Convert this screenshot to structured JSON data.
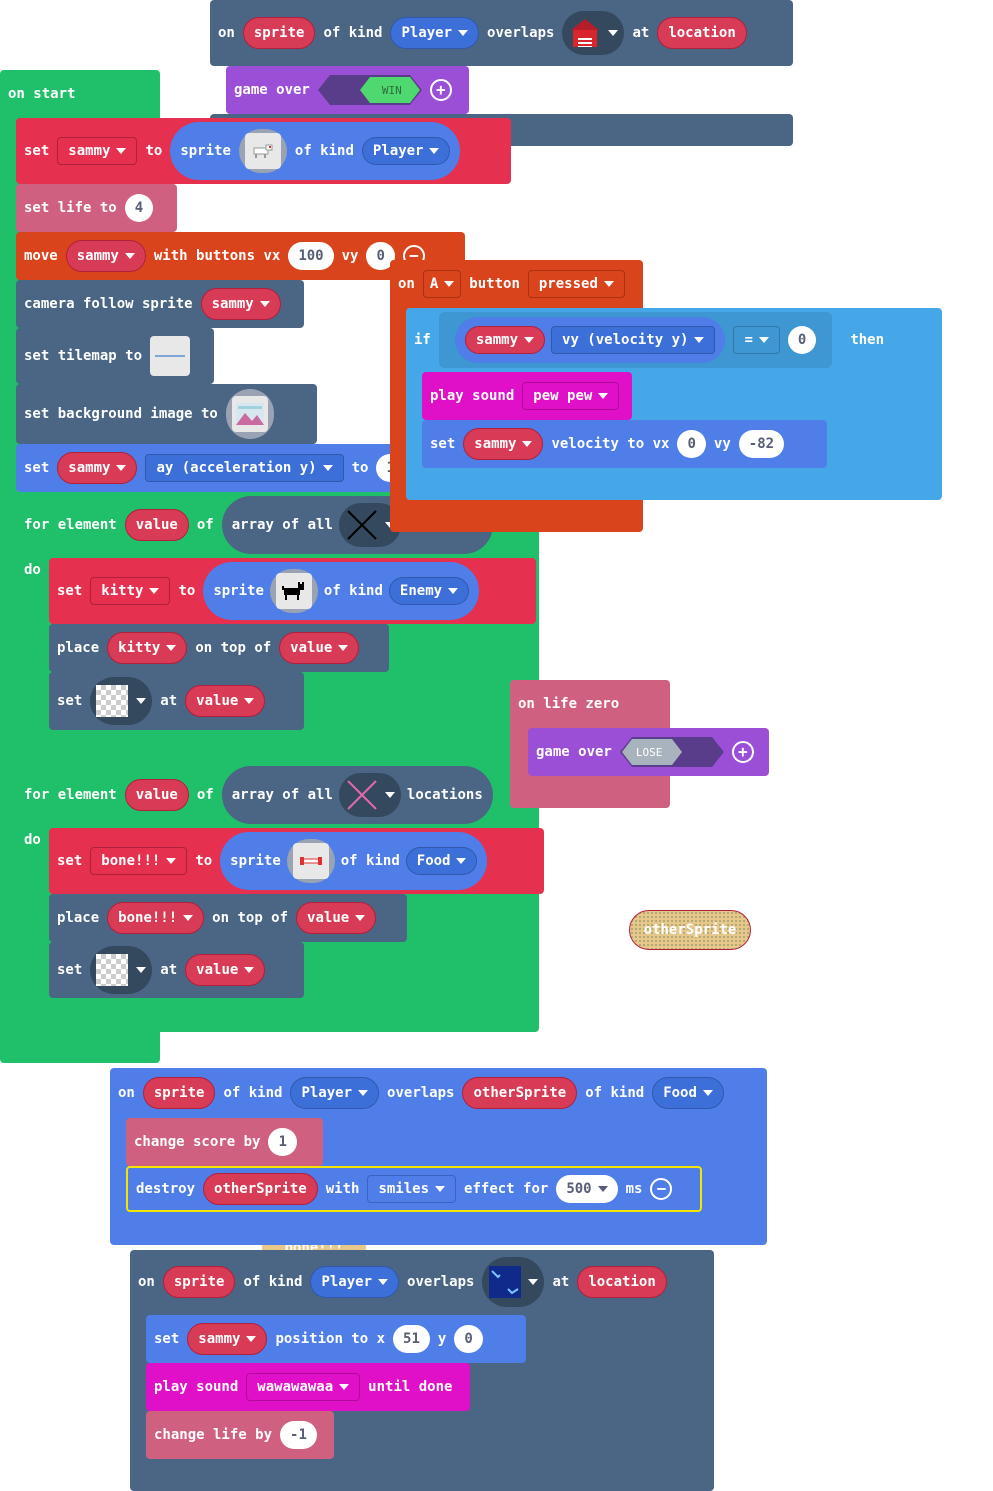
{
  "colors": {
    "green": "#20c06a",
    "red": "#e63050",
    "slate": "#4b6584",
    "pink": "#d06080",
    "purple": "#9b4fd6",
    "orange": "#d9441c",
    "sky": "#45a7e8",
    "blue": "#4f7ee8",
    "magenta": "#e010c8",
    "var": "#d83b56"
  },
  "top_overlap": {
    "on": "on",
    "sprite": "sprite",
    "of_kind": "of kind",
    "kind": "Player",
    "overlaps": "overlaps",
    "at": "at",
    "location": "location",
    "tile_icon": "red-house-icon",
    "game_over": "game over",
    "win": "WIN"
  },
  "on_start": {
    "label": "on start",
    "set": "set",
    "sammy": "sammy",
    "to": "to",
    "sprite": "sprite",
    "of_kind": "of kind",
    "player": "Player",
    "set_life_to": "set life to",
    "life": "4",
    "move": "move",
    "with_buttons_vx": "with buttons vx",
    "vx": "100",
    "vy_label": "vy",
    "vy": "0",
    "camera_follow": "camera follow sprite",
    "set_tilemap": "set tilemap to",
    "set_background": "set background image to",
    "ay": "ay (acceleration y)",
    "ay_to": "to",
    "ay_value": "100",
    "for_element": "for element",
    "value": "value",
    "of": "of",
    "array_of_all": "array of all",
    "locations": "locations",
    "do": "do",
    "kitty": "kitty",
    "enemy": "Enemy",
    "place": "place",
    "on_top_of": "on top of",
    "at": "at",
    "bone": "bone!!!",
    "food": "Food"
  },
  "button_event": {
    "on": "on",
    "button": "A",
    "button_label": "button",
    "pressed": "pressed",
    "if": "if",
    "sammy": "sammy",
    "vy_prop": "vy (velocity y)",
    "op": "=",
    "cmp": "0",
    "then": "then",
    "play_sound": "play sound",
    "sound": "pew pew",
    "set": "set",
    "velocity_to_vx": "velocity to vx",
    "vx": "0",
    "vy_label": "vy",
    "vy": "-82"
  },
  "life_zero": {
    "label": "on life zero",
    "game_over": "game over",
    "lose": "LOSE"
  },
  "loose_var": "otherSprite",
  "food_overlap": {
    "on": "on",
    "sprite": "sprite",
    "of_kind": "of kind",
    "player": "Player",
    "overlaps": "overlaps",
    "other": "otherSprite",
    "of_kind2": "of kind",
    "food": "Food",
    "change_score_by": "change score by",
    "score": "1",
    "destroy": "destroy",
    "with": "with",
    "effect": "smiles",
    "effect_for": "effect for",
    "ms_value": "500",
    "ms": "ms"
  },
  "ghost_label": "bone!!!",
  "water_overlap": {
    "on": "on",
    "sprite": "sprite",
    "of_kind": "of kind",
    "player": "Player",
    "overlaps": "overlaps",
    "at": "at",
    "location": "location",
    "set": "set",
    "sammy": "sammy",
    "position_to_x": "position to x",
    "x": "51",
    "y_label": "y",
    "y": "0",
    "play_sound": "play sound",
    "sound": "wawawawaa",
    "until_done": "until done",
    "change_life_by": "change life by",
    "life_change": "-1"
  }
}
